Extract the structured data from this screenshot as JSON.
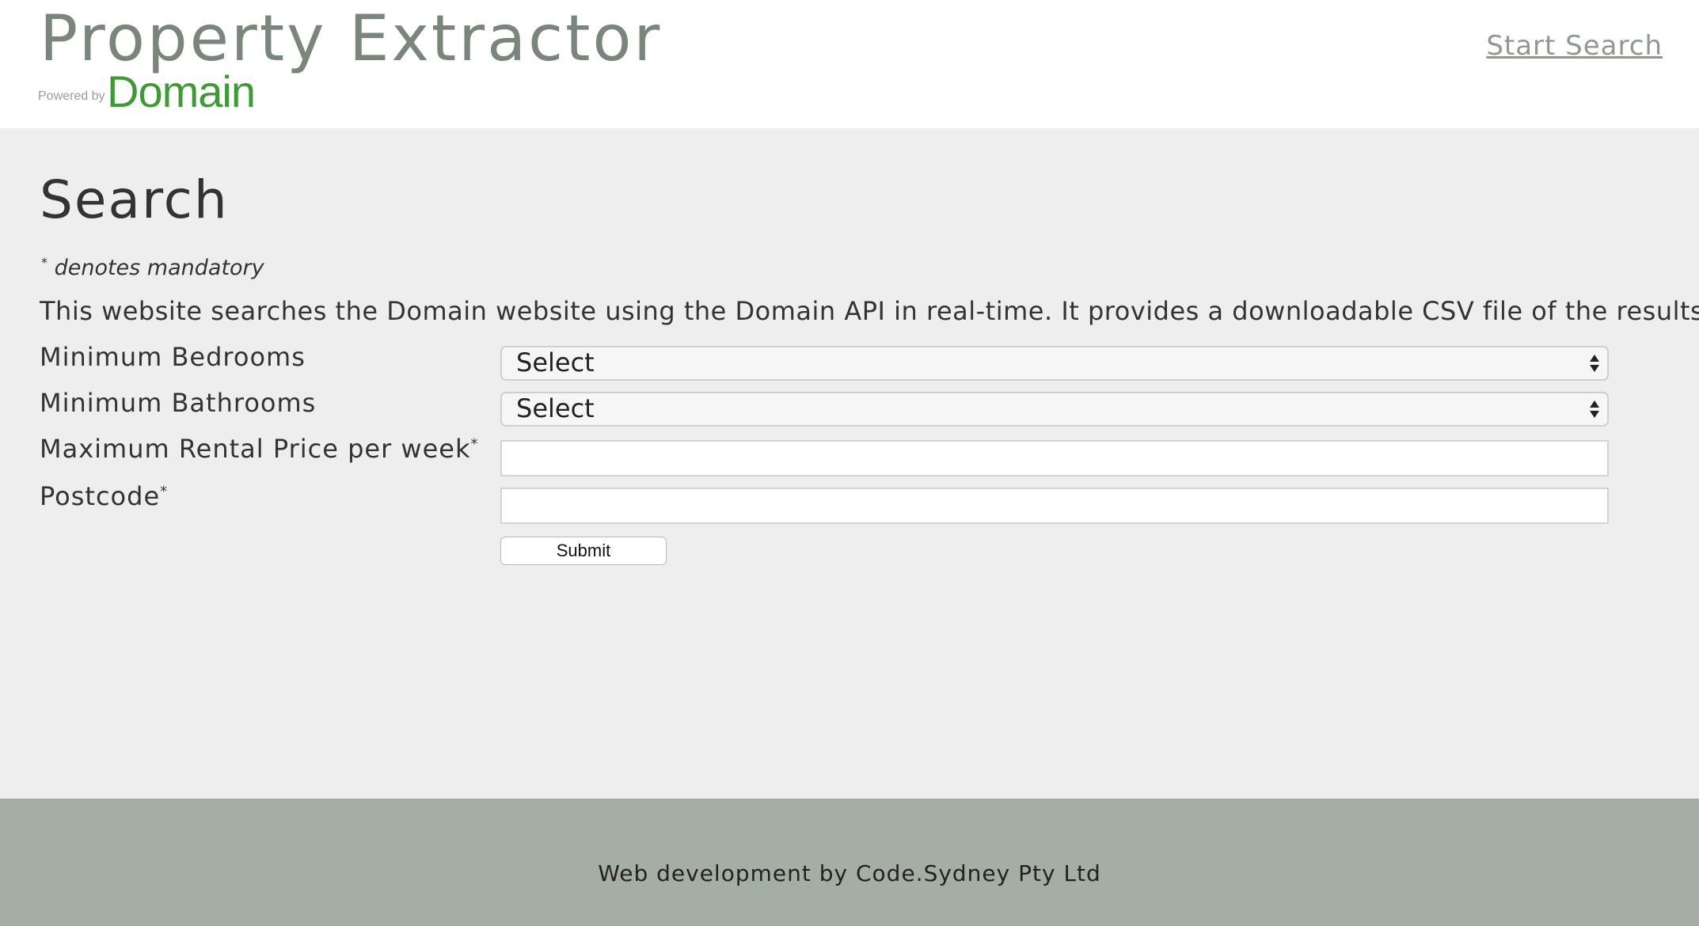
{
  "header": {
    "title": "Property Extractor",
    "powered_by": "Powered by",
    "brand": "Domain",
    "nav_link": "Start Search"
  },
  "main": {
    "page_title": "Search",
    "mandatory_star": "*",
    "mandatory_note": " denotes mandatory",
    "description": "This website searches the Domain website using the Domain API in real-time. It provides a downloadable CSV file of the results.",
    "fields": {
      "bedrooms": {
        "label": "Minimum Bedrooms",
        "value": "Select"
      },
      "bathrooms": {
        "label": "Minimum Bathrooms",
        "value": "Select"
      },
      "price": {
        "label": "Maximum Rental Price per week",
        "required_mark": "*",
        "value": ""
      },
      "postcode": {
        "label": "Postcode",
        "required_mark": "*",
        "value": ""
      }
    },
    "submit_label": "Submit"
  },
  "footer": {
    "text": "Web development by Code.Sydney Pty Ltd"
  },
  "colors": {
    "title": "#7a857c",
    "brand": "#3e9a34",
    "main_bg": "#eeeeee",
    "footer_bg": "#a5aea5"
  },
  "icons": {
    "select_arrows": "updown-arrows-icon"
  }
}
